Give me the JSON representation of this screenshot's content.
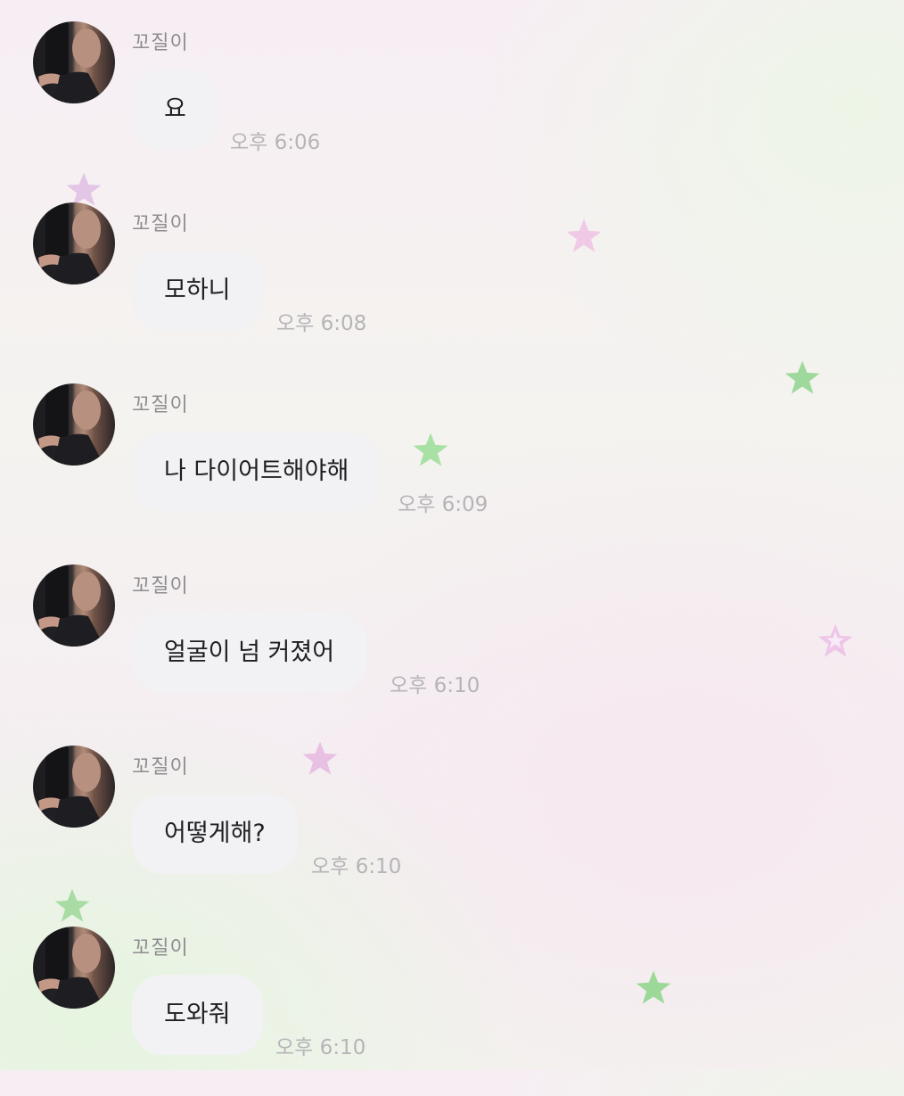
{
  "chat": {
    "messages": [
      {
        "sender": "꼬질이",
        "text": "요",
        "time": "오후 6:06"
      },
      {
        "sender": "꼬질이",
        "text": "모하니",
        "time": "오후 6:08"
      },
      {
        "sender": "꼬질이",
        "text": "나 다이어트해야해",
        "time": "오후 6:09"
      },
      {
        "sender": "꼬질이",
        "text": "얼굴이 넘 커졌어",
        "time": "오후 6:10"
      },
      {
        "sender": "꼬질이",
        "text": "어떻게해?",
        "time": "오후 6:10"
      },
      {
        "sender": "꼬질이",
        "text": "도와줘",
        "time": "오후 6:10"
      }
    ]
  },
  "decor": {
    "stars": [
      {
        "name": "star-icon",
        "color": "#e3c6e6"
      },
      {
        "name": "star-icon",
        "color": "#f0c9e6"
      },
      {
        "name": "star-icon",
        "color": "#9fd89c"
      },
      {
        "name": "star-icon",
        "color": "#a9e0a3"
      },
      {
        "name": "star-icon",
        "color": "#eec6e8"
      },
      {
        "name": "star-icon",
        "color": "#e8c0e3"
      },
      {
        "name": "star-icon",
        "color": "#a8dca4"
      },
      {
        "name": "star-icon",
        "color": "#9cd898"
      }
    ]
  }
}
